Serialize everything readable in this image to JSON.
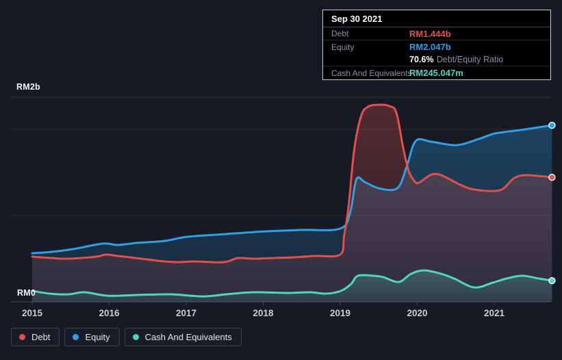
{
  "colors": {
    "debt": "#e2504d",
    "equity": "#2f9fe8",
    "cash": "#4fd6c0",
    "page_bg": "#151a24",
    "tooltip_bg": "#010103",
    "tooltip_border": "#c9cbd0",
    "grid": "#2a303c",
    "axis": "#444b59",
    "text_muted": "#8b9199",
    "text_axis": "#c9ced6"
  },
  "tooltip": {
    "date": "Sep 30 2021",
    "debt_label": "Debt",
    "debt_value": "RM1.444b",
    "equity_label": "Equity",
    "equity_value": "RM2.047b",
    "ratio_value": "70.6%",
    "ratio_label": "Debt/Equity Ratio",
    "cash_label": "Cash And Equivalents",
    "cash_value": "RM245.047m"
  },
  "legend": [
    {
      "label": "Debt",
      "color_key": "debt"
    },
    {
      "label": "Equity",
      "color_key": "equity"
    },
    {
      "label": "Cash And Equivalents",
      "color_key": "cash"
    }
  ],
  "chart_data": {
    "type": "area",
    "unit": "RM billions",
    "x_ticks": [
      "2015",
      "2016",
      "2017",
      "2018",
      "2019",
      "2020",
      "2021"
    ],
    "y_axis_labels": {
      "top": "RM2b",
      "zero": "RM0"
    },
    "xlim": [
      2014.7,
      2021.78
    ],
    "ylim": [
      0,
      2.37
    ],
    "y_gridline_values": [
      1,
      2
    ],
    "grid": "on",
    "legend_position": "bottom-left",
    "series": [
      {
        "key": "equity",
        "name": "Equity",
        "color": "#2f9fe8",
        "fill_top": 0.34,
        "fill_bottom": 0.1,
        "points": [
          [
            2015.0,
            0.563
          ],
          [
            2015.25,
            0.579
          ],
          [
            2015.53,
            0.611
          ],
          [
            2015.92,
            0.675
          ],
          [
            2016.11,
            0.659
          ],
          [
            2016.36,
            0.683
          ],
          [
            2016.72,
            0.706
          ],
          [
            2017.01,
            0.754
          ],
          [
            2017.52,
            0.786
          ],
          [
            2018.02,
            0.817
          ],
          [
            2018.49,
            0.833
          ],
          [
            2019.0,
            0.849
          ],
          [
            2019.13,
            1.04
          ],
          [
            2019.21,
            1.421
          ],
          [
            2019.32,
            1.389
          ],
          [
            2019.5,
            1.317
          ],
          [
            2019.74,
            1.317
          ],
          [
            2019.86,
            1.556
          ],
          [
            2019.98,
            1.865
          ],
          [
            2020.18,
            1.857
          ],
          [
            2020.51,
            1.817
          ],
          [
            2020.8,
            1.889
          ],
          [
            2021.01,
            1.952
          ],
          [
            2021.34,
            1.992
          ],
          [
            2021.75,
            2.047
          ]
        ]
      },
      {
        "key": "debt",
        "name": "Debt",
        "color": "#e2504d",
        "fill_top": 0.3,
        "fill_bottom": 0.12,
        "points": [
          [
            2015.0,
            0.524
          ],
          [
            2015.25,
            0.508
          ],
          [
            2015.47,
            0.5
          ],
          [
            2015.83,
            0.524
          ],
          [
            2015.96,
            0.548
          ],
          [
            2016.11,
            0.532
          ],
          [
            2016.27,
            0.516
          ],
          [
            2016.49,
            0.492
          ],
          [
            2016.72,
            0.468
          ],
          [
            2016.89,
            0.46
          ],
          [
            2017.12,
            0.468
          ],
          [
            2017.49,
            0.46
          ],
          [
            2017.67,
            0.508
          ],
          [
            2017.87,
            0.5
          ],
          [
            2018.14,
            0.508
          ],
          [
            2018.4,
            0.516
          ],
          [
            2018.67,
            0.532
          ],
          [
            2019.0,
            0.548
          ],
          [
            2019.05,
            0.762
          ],
          [
            2019.11,
            1.119
          ],
          [
            2019.18,
            1.754
          ],
          [
            2019.27,
            2.151
          ],
          [
            2019.36,
            2.262
          ],
          [
            2019.51,
            2.286
          ],
          [
            2019.64,
            2.27
          ],
          [
            2019.73,
            2.19
          ],
          [
            2019.82,
            1.778
          ],
          [
            2019.89,
            1.516
          ],
          [
            2019.96,
            1.405
          ],
          [
            2020.02,
            1.381
          ],
          [
            2020.24,
            1.484
          ],
          [
            2020.56,
            1.357
          ],
          [
            2020.74,
            1.302
          ],
          [
            2021.07,
            1.294
          ],
          [
            2021.25,
            1.429
          ],
          [
            2021.38,
            1.468
          ],
          [
            2021.56,
            1.46
          ],
          [
            2021.75,
            1.444
          ]
        ]
      },
      {
        "key": "cash",
        "name": "Cash And Equivalents",
        "color": "#4fd6c0",
        "fill_top": 0.3,
        "fill_bottom": 0.1,
        "points": [
          [
            2015.0,
            0.127
          ],
          [
            2015.23,
            0.095
          ],
          [
            2015.47,
            0.087
          ],
          [
            2015.68,
            0.111
          ],
          [
            2015.98,
            0.071
          ],
          [
            2016.36,
            0.079
          ],
          [
            2016.8,
            0.087
          ],
          [
            2017.22,
            0.063
          ],
          [
            2017.52,
            0.087
          ],
          [
            2017.87,
            0.111
          ],
          [
            2018.32,
            0.103
          ],
          [
            2018.61,
            0.111
          ],
          [
            2018.82,
            0.095
          ],
          [
            2019.01,
            0.127
          ],
          [
            2019.14,
            0.206
          ],
          [
            2019.23,
            0.302
          ],
          [
            2019.43,
            0.302
          ],
          [
            2019.56,
            0.286
          ],
          [
            2019.76,
            0.23
          ],
          [
            2019.92,
            0.325
          ],
          [
            2020.09,
            0.365
          ],
          [
            2020.31,
            0.325
          ],
          [
            2020.48,
            0.27
          ],
          [
            2020.74,
            0.167
          ],
          [
            2020.98,
            0.222
          ],
          [
            2021.16,
            0.27
          ],
          [
            2021.36,
            0.302
          ],
          [
            2021.58,
            0.27
          ],
          [
            2021.75,
            0.245
          ]
        ]
      }
    ]
  }
}
